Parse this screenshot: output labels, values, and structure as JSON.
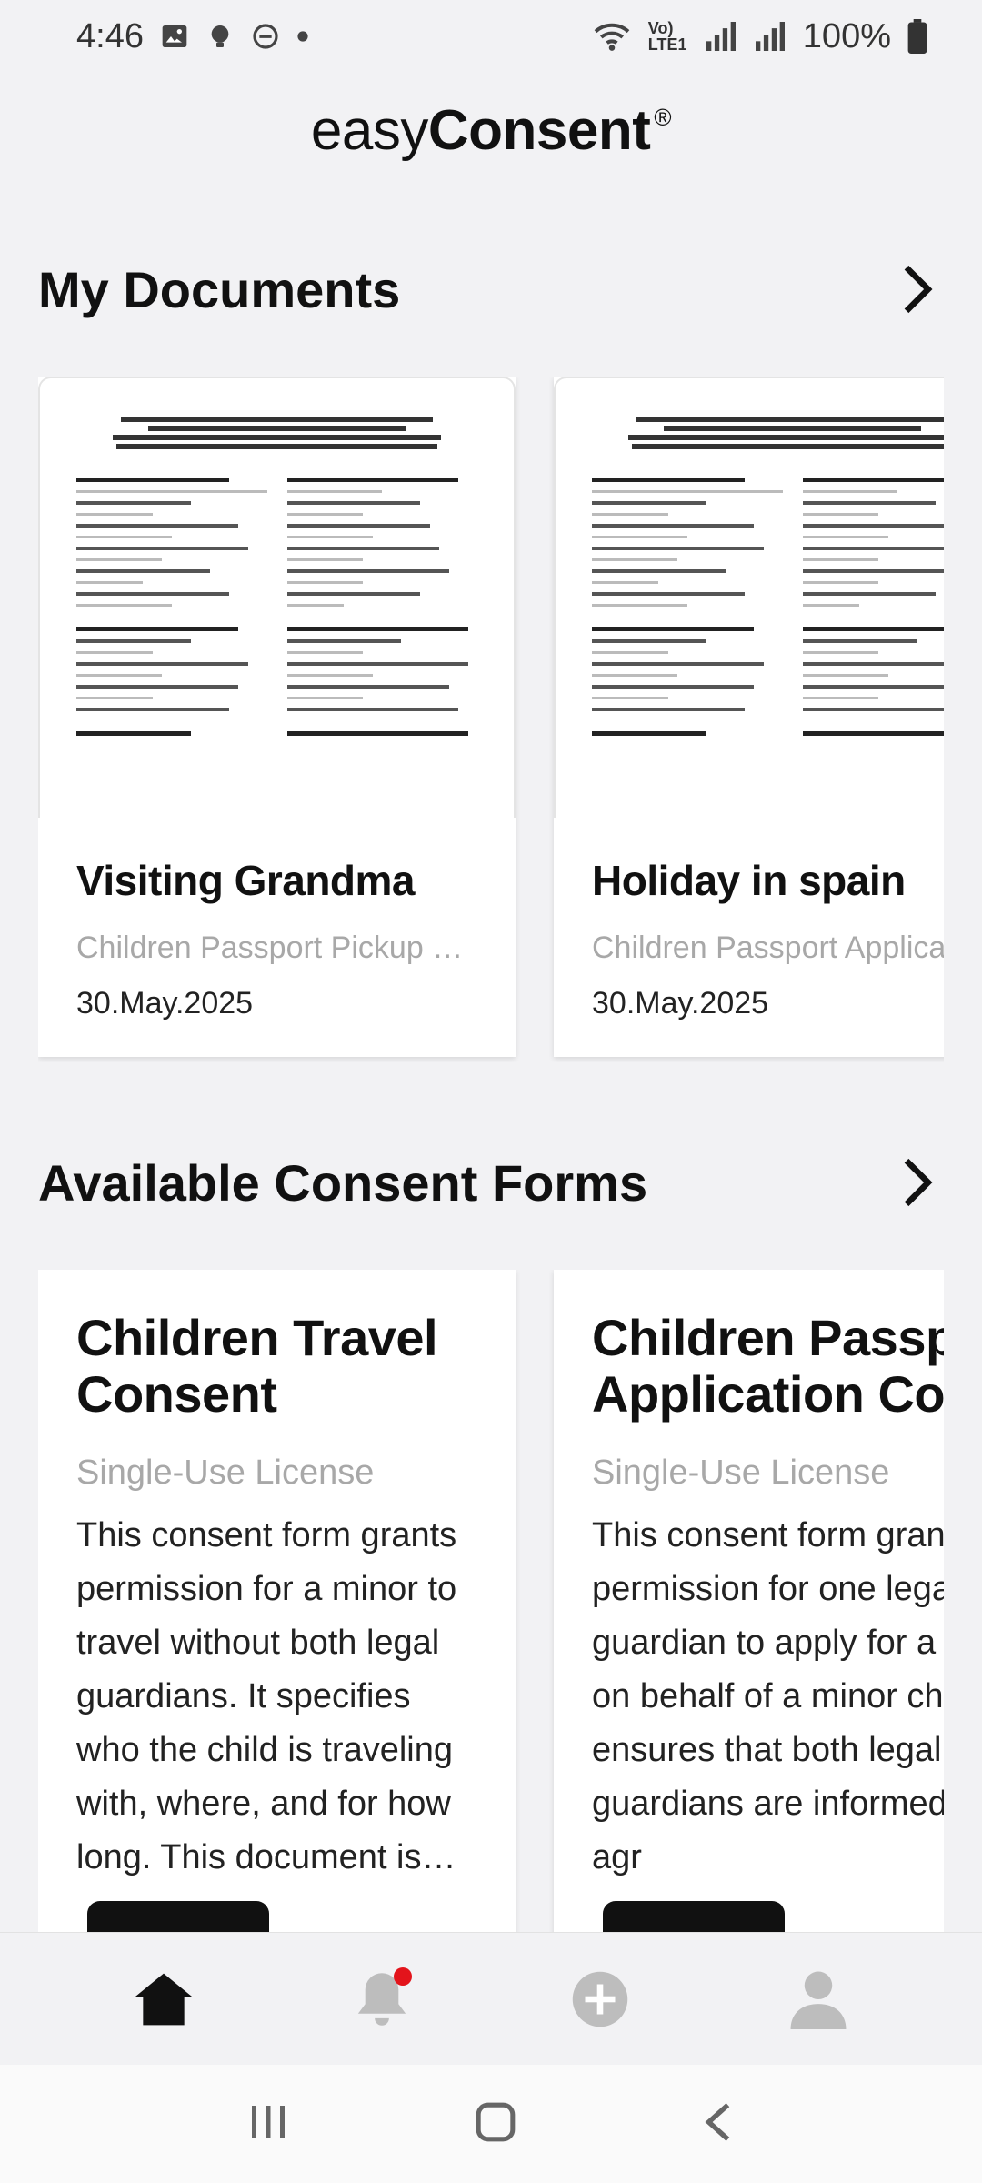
{
  "status_bar": {
    "time": "4:46",
    "battery": "100%",
    "network_label": "Vo) LTE1"
  },
  "logo": {
    "light": "easy",
    "bold": "Consent",
    "mark": "®"
  },
  "my_documents": {
    "title": "My Documents",
    "items": [
      {
        "title": "Visiting Grandma",
        "subtitle": "Children Passport Pickup Con...",
        "date": "30.May.2025"
      },
      {
        "title": "Holiday in spain",
        "subtitle": "Children Passport Applicatio",
        "date": "30.May.2025"
      }
    ]
  },
  "consent_forms": {
    "title": "Available Consent Forms",
    "items": [
      {
        "title": "Children Travel Consent",
        "license": "Single-Use License",
        "description": "This consent form grants permission for a minor to travel without both legal guardians. It specifies who the child is traveling with, where, and for how long. This document is o..."
      },
      {
        "title": "Children Passport Application Consent",
        "license": "Single-Use License",
        "description": "This consent form grants permission for one legal guardian to apply for a passport on behalf of a minor child. It ensures that both legal guardians are informed and in agr"
      }
    ]
  },
  "bottom_nav": {
    "items": [
      "home-icon",
      "bell-icon",
      "add-circle-icon",
      "profile-icon"
    ],
    "active": "home-icon",
    "notification_color": "#e3141b"
  }
}
